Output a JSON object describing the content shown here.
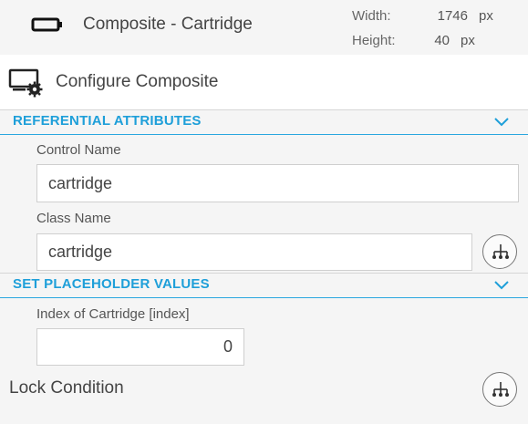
{
  "header": {
    "title": "Composite - Cartridge",
    "icon": "cartridge-icon",
    "width_label": "Width:",
    "width_value": "1746",
    "width_unit": "px",
    "height_label": "Height:",
    "height_value": "40",
    "height_unit": "px"
  },
  "config": {
    "title": "Configure Composite",
    "icon": "configure-monitor-gear-icon"
  },
  "sections": {
    "referential": {
      "title": "REFERENTIAL ATTRIBUTES",
      "control_name_label": "Control Name",
      "control_name_value": "cartridge",
      "class_name_label": "Class Name",
      "class_name_value": "cartridge"
    },
    "placeholder": {
      "title": "SET PLACEHOLDER VALUES",
      "index_label": "Index of Cartridge [index]",
      "index_value": "0"
    }
  },
  "lock": {
    "label": "Lock Condition"
  },
  "colors": {
    "accent": "#1e9fd9",
    "background": "#f5f5f5"
  }
}
